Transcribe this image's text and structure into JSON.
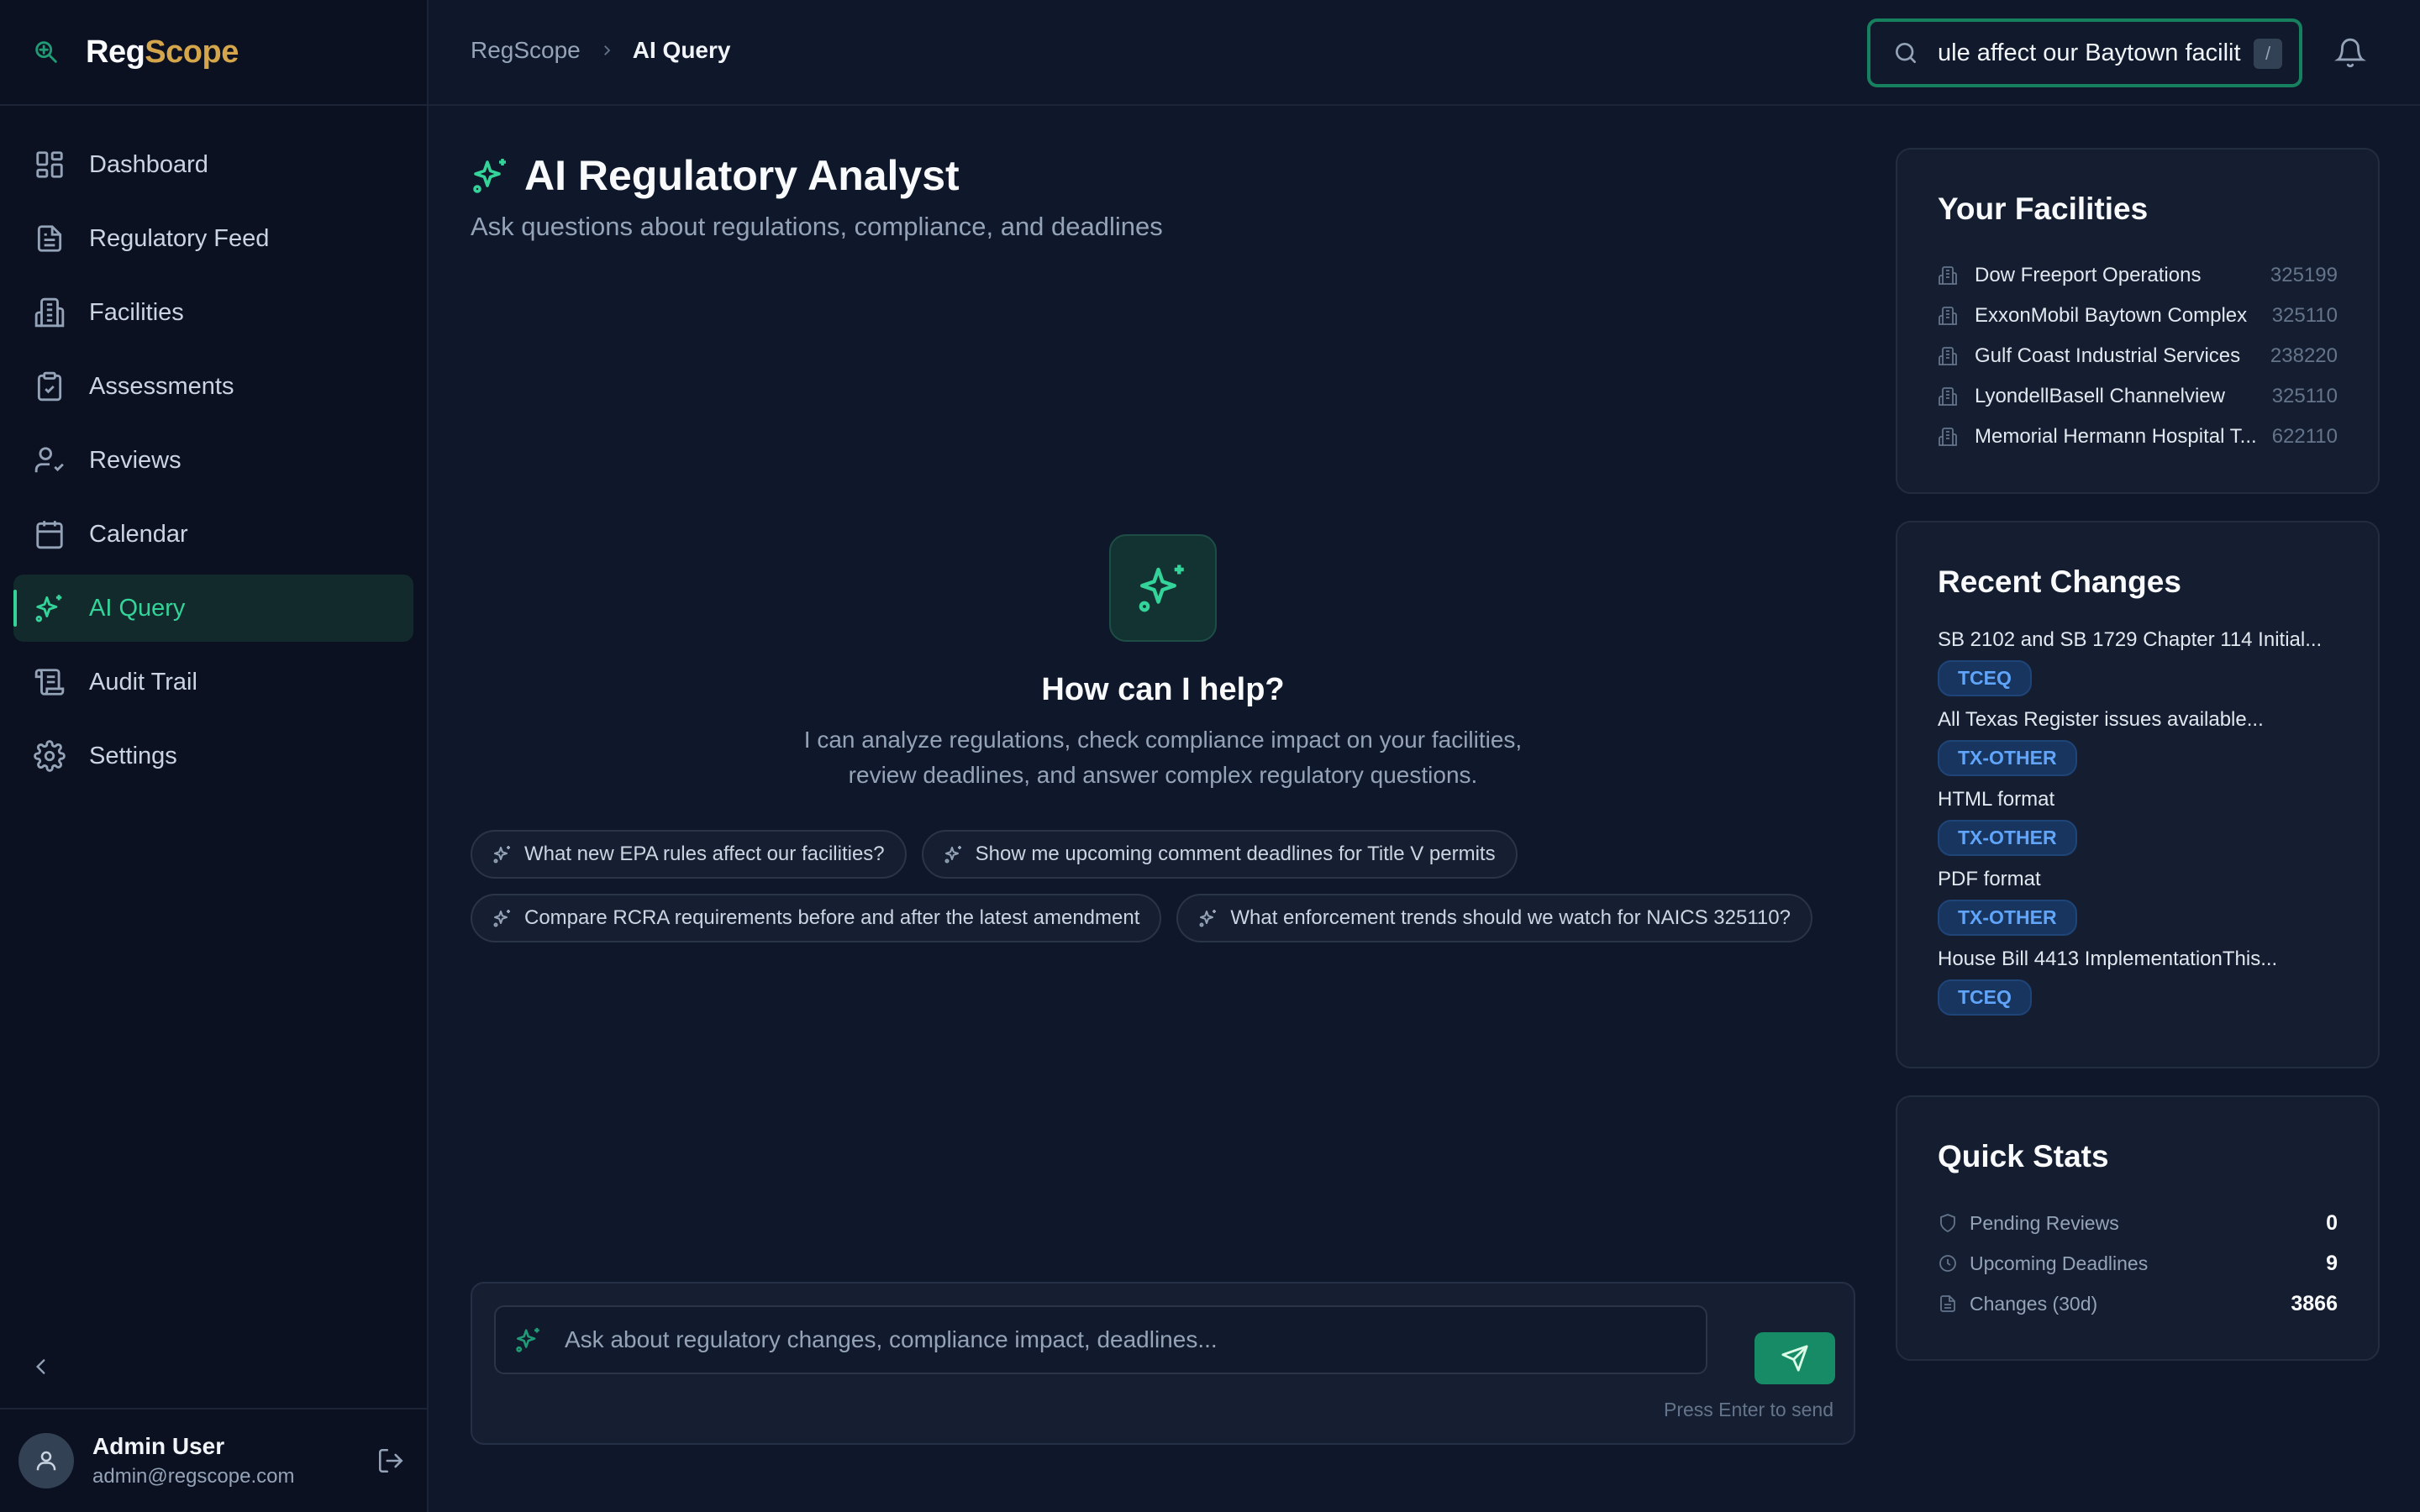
{
  "brand": {
    "part1": "Reg",
    "part2": "Scope"
  },
  "nav": [
    {
      "label": "Dashboard",
      "icon": "dashboard-icon"
    },
    {
      "label": "Regulatory Feed",
      "icon": "document-icon"
    },
    {
      "label": "Facilities",
      "icon": "building-icon"
    },
    {
      "label": "Assessments",
      "icon": "clipboard-check-icon"
    },
    {
      "label": "Reviews",
      "icon": "user-check-icon"
    },
    {
      "label": "Calendar",
      "icon": "calendar-icon"
    },
    {
      "label": "AI Query",
      "icon": "sparkles-icon",
      "active": true
    },
    {
      "label": "Audit Trail",
      "icon": "scroll-icon"
    },
    {
      "label": "Settings",
      "icon": "gear-icon"
    }
  ],
  "user": {
    "name": "Admin User",
    "email": "admin@regscope.com"
  },
  "breadcrumb": {
    "root": "RegScope",
    "current": "AI Query"
  },
  "search": {
    "value": "ule affect our Baytown facilit",
    "shortcut": "/"
  },
  "page": {
    "title": "AI Regulatory Analyst",
    "subtitle": "Ask questions about regulations, compliance, and deadlines"
  },
  "hero": {
    "title": "How can I help?",
    "line1": "I can analyze regulations, check compliance impact on your facilities,",
    "line2": "review deadlines, and answer complex regulatory questions."
  },
  "suggestions": [
    "What new EPA rules affect our facilities?",
    "Show me upcoming comment deadlines for Title V permits",
    "Compare RCRA requirements before and after the latest amendment",
    "What enforcement trends should we watch for NAICS 325110?"
  ],
  "composer": {
    "placeholder": "Ask about regulatory changes, compliance impact, deadlines...",
    "hint": "Press Enter to send"
  },
  "facilities": {
    "title": "Your Facilities",
    "items": [
      {
        "name": "Dow Freeport Operations",
        "code": "325199"
      },
      {
        "name": "ExxonMobil Baytown Complex",
        "code": "325110"
      },
      {
        "name": "Gulf Coast Industrial Services",
        "code": "238220"
      },
      {
        "name": "LyondellBasell Channelview",
        "code": "325110"
      },
      {
        "name": "Memorial Hermann Hospital T...",
        "code": "622110"
      }
    ]
  },
  "changes": {
    "title": "Recent Changes",
    "items": [
      {
        "title": "SB 2102 and SB 1729 Chapter 114 Initial...",
        "tag": "TCEQ"
      },
      {
        "title": "All Texas Register issues available...",
        "tag": "TX-OTHER"
      },
      {
        "title": "HTML format",
        "tag": "TX-OTHER"
      },
      {
        "title": "PDF format",
        "tag": "TX-OTHER"
      },
      {
        "title": "House Bill 4413 ImplementationThis...",
        "tag": "TCEQ"
      }
    ]
  },
  "stats": {
    "title": "Quick Stats",
    "items": [
      {
        "label": "Pending Reviews",
        "value": "0"
      },
      {
        "label": "Upcoming Deadlines",
        "value": "9"
      },
      {
        "label": "Changes (30d)",
        "value": "3866"
      }
    ]
  },
  "colors": {
    "accent": "#34d399",
    "brand_gold": "#d4a54a",
    "badge_blue": "#60a5fa",
    "background": "#0f172a"
  }
}
